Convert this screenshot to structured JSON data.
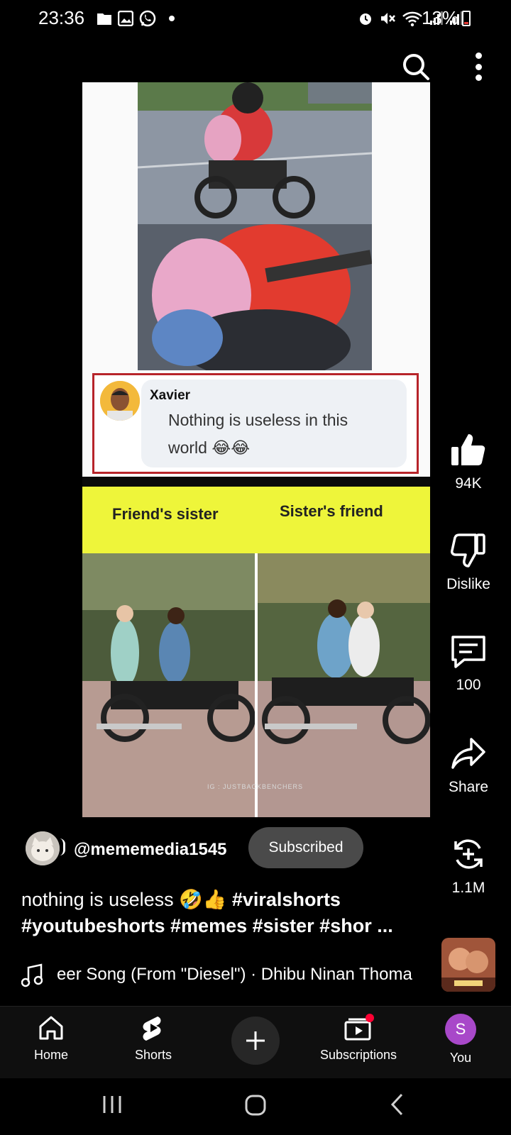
{
  "status_bar": {
    "time": "23:36",
    "battery": "13%",
    "icons_left": [
      "folder-icon",
      "gallery-icon",
      "whatsapp-icon",
      "dot-icon"
    ],
    "icons_right": [
      "alarm-icon",
      "mute-icon",
      "wifi-icon",
      "signal-icon",
      "signal-icon"
    ]
  },
  "top_bar": {
    "icons": [
      "search-icon",
      "more-vert-icon"
    ]
  },
  "video": {
    "comment": {
      "name": "Xavier",
      "text": "Nothing is useless in this world 😂😂"
    },
    "labels": {
      "left": "Friend's sister",
      "right": "Sister's friend"
    },
    "watermark": "IG : JUSTBACKBENCHERS"
  },
  "actions": {
    "like_count": "94K",
    "dislike_label": "Dislike",
    "comment_count": "100",
    "share_label": "Share",
    "remix_count": "1.1M"
  },
  "channel": {
    "handle": "@mememedia1545",
    "subscribe_label": "Subscribed"
  },
  "caption": {
    "text": "nothing is useless 🤣👍 ",
    "hashtags_line1": "#viralshorts",
    "hashtags_line2": "#youtubeshorts #memes #sister #shor ..."
  },
  "music": {
    "title": "eer Song (From \"Diesel\") · Dhibu Ninan Thoma"
  },
  "bottom_nav": {
    "home": "Home",
    "shorts": "Shorts",
    "subscriptions": "Subscriptions",
    "you": "You",
    "you_initial": "S"
  },
  "colors": {
    "background": "#000000",
    "accent_yellow": "#eef53a",
    "comment_border": "#b7242a",
    "you_avatar": "#a848c9",
    "notification_dot": "#ff0033"
  }
}
